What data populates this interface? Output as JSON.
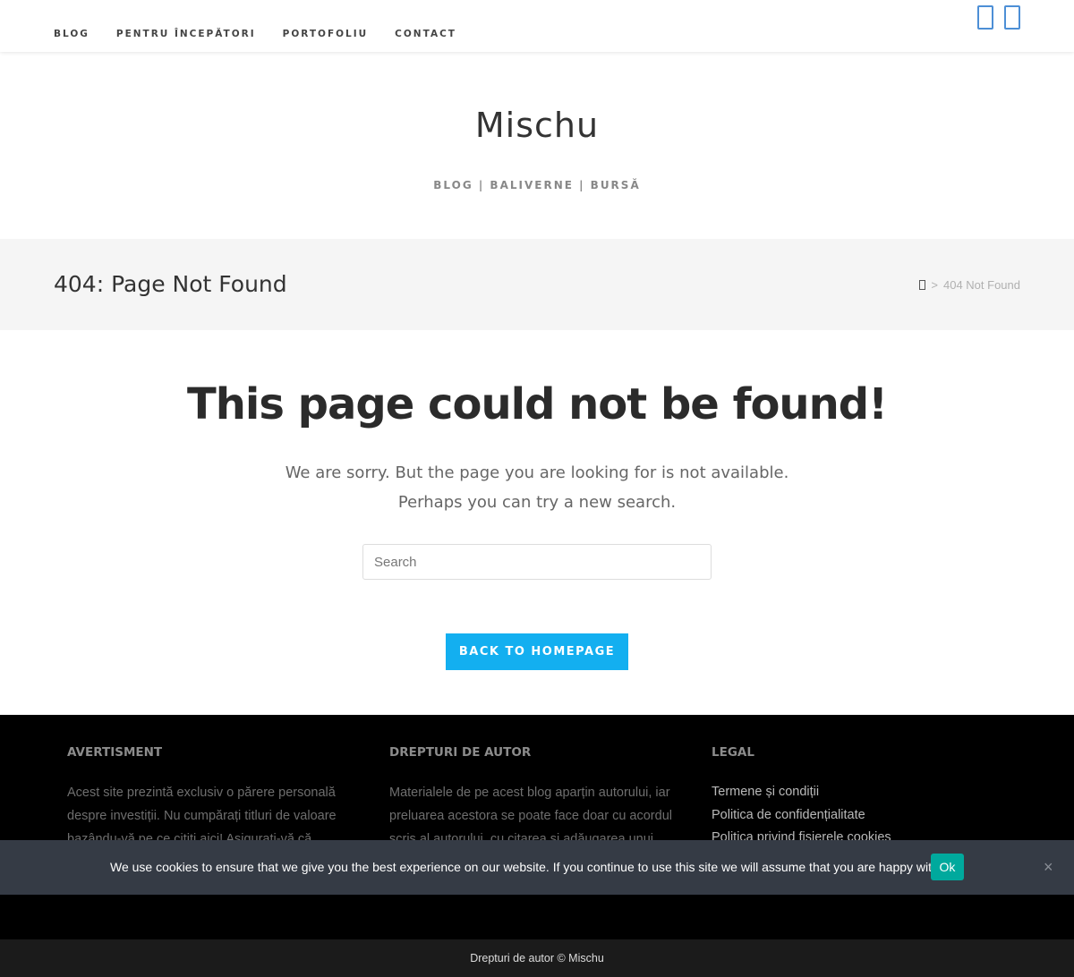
{
  "nav": {
    "items": [
      {
        "label": "BLOG"
      },
      {
        "label": "PENTRU ÎNCEPĂTORI"
      },
      {
        "label": "PORTOFOLIU"
      },
      {
        "label": "CONTACT"
      }
    ],
    "social_icons": [
      "social-icon",
      "social-icon"
    ]
  },
  "branding": {
    "site_title": "Mischu",
    "tagline": "BLOG | BALIVERNE | BURSĂ"
  },
  "page_header": {
    "title": "404: Page Not Found",
    "breadcrumb": {
      "home_icon": "home-icon",
      "separator": ">",
      "current": "404 Not Found"
    }
  },
  "main": {
    "heading": "This page could not be found!",
    "line1": "We are sorry. But the page you are looking for is not available.",
    "line2": "Perhaps you can try a new search.",
    "search_placeholder": "Search",
    "button_label": "BACK TO HOMEPAGE",
    "button_color": "#13aff0"
  },
  "footer": {
    "col1": {
      "title": "AVERTISMENT",
      "text": "Acest site prezintă exclusiv o părere personală despre investiții. Nu cumpărați titluri de valoare bazându-vă pe ce citiți aici! Asigurați-vă că"
    },
    "col2": {
      "title": "DREPTURI DE AUTOR",
      "text": "Materialele de pe acest blog aparțin autorului, iar preluarea acestora se poate face doar cu acordul scris al autorului, cu citarea și adăugarea unui link"
    },
    "col3": {
      "title": "LEGAL",
      "links": [
        {
          "label": "Termene și condiții"
        },
        {
          "label": "Politica de confidențialitate"
        },
        {
          "label": "Politica privind fișierele cookies"
        }
      ]
    }
  },
  "cookie_bar": {
    "text": "We use cookies to ensure that we give you the best experience on our website. If you continue to use this site we will assume that you are happy with it.",
    "ok_label": "Ok",
    "close_icon": "×",
    "ok_color": "#00a99d"
  },
  "bottom_bar": {
    "copyright": "Drepturi de autor © Mischu"
  }
}
